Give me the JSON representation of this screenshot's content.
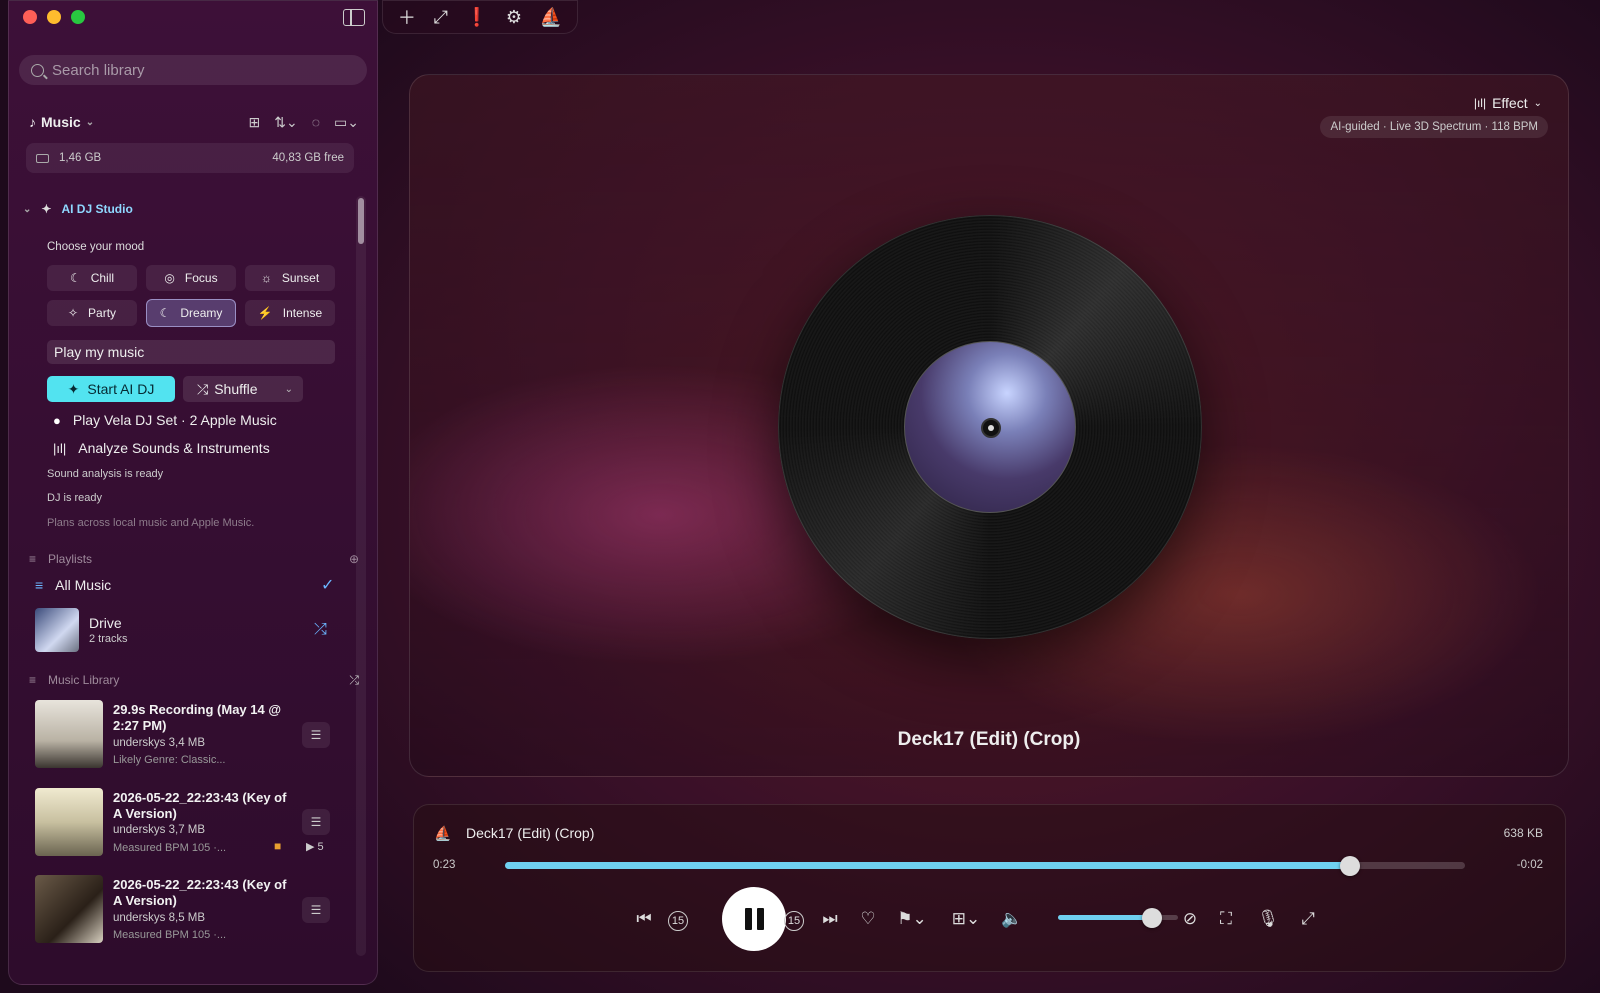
{
  "sidebar": {
    "search_placeholder": "Search library",
    "library_selector": "Music",
    "storage_used": "1,46 GB",
    "storage_free": "40,83 GB free",
    "ai_dj": {
      "title": "AI DJ Studio",
      "mood_label": "Choose your mood",
      "moods": [
        {
          "label": "Chill",
          "icon": "chill-icon"
        },
        {
          "label": "Focus",
          "icon": "focus-icon"
        },
        {
          "label": "Sunset",
          "icon": "sunset-icon"
        },
        {
          "label": "Party",
          "icon": "party-icon"
        },
        {
          "label": "Dreamy",
          "icon": "moon-icon",
          "selected": true
        },
        {
          "label": "Intense",
          "icon": "bolt-icon"
        }
      ],
      "prompt_value": "Play my music",
      "start_label": "Start AI DJ",
      "shuffle_label": "Shuffle",
      "apple_action": "Play Vela DJ Set · 2 Apple Music",
      "analyze_action": "Analyze Sounds & Instruments",
      "status_sound": "Sound analysis is ready",
      "status_dj": "DJ is ready",
      "status_plans": "Plans across local music and Apple Music."
    },
    "playlists": {
      "header": "Playlists",
      "all_music": "All Music",
      "items": [
        {
          "name": "Drive",
          "count": "2 tracks"
        }
      ]
    },
    "library": {
      "header": "Music Library",
      "tracks": [
        {
          "title": "29.9s Recording (May 14 @ 2:27 PM)",
          "meta": "underskys 3,4 MB",
          "sub": "Likely Genre: Classic..."
        },
        {
          "title": "2026-05-22_22:23:43 (Key of A Version)",
          "meta": "underskys 3,7 MB",
          "sub": "Measured BPM 105 ·...",
          "play_count": "5"
        },
        {
          "title": "2026-05-22_22:23:43 (Key of A Version)",
          "meta": "underskys 8,5 MB",
          "sub": "Measured BPM 105 ·..."
        }
      ]
    }
  },
  "stage": {
    "effect_label": "Effect",
    "spectrum_label": "AI-guided · Live 3D Spectrum · 118 BPM",
    "now_title": "Deck17 (Edit) (Crop)"
  },
  "player": {
    "title": "Deck17 (Edit) (Crop)",
    "size": "638 KB",
    "elapsed": "0:23",
    "remaining": "-0:02",
    "progress": 0.88,
    "volume": 0.78,
    "skip_seconds": "15"
  },
  "colors": {
    "accent": "#52e3f0",
    "progress": "#6fd0f0",
    "selection": "#6bb6ff"
  }
}
